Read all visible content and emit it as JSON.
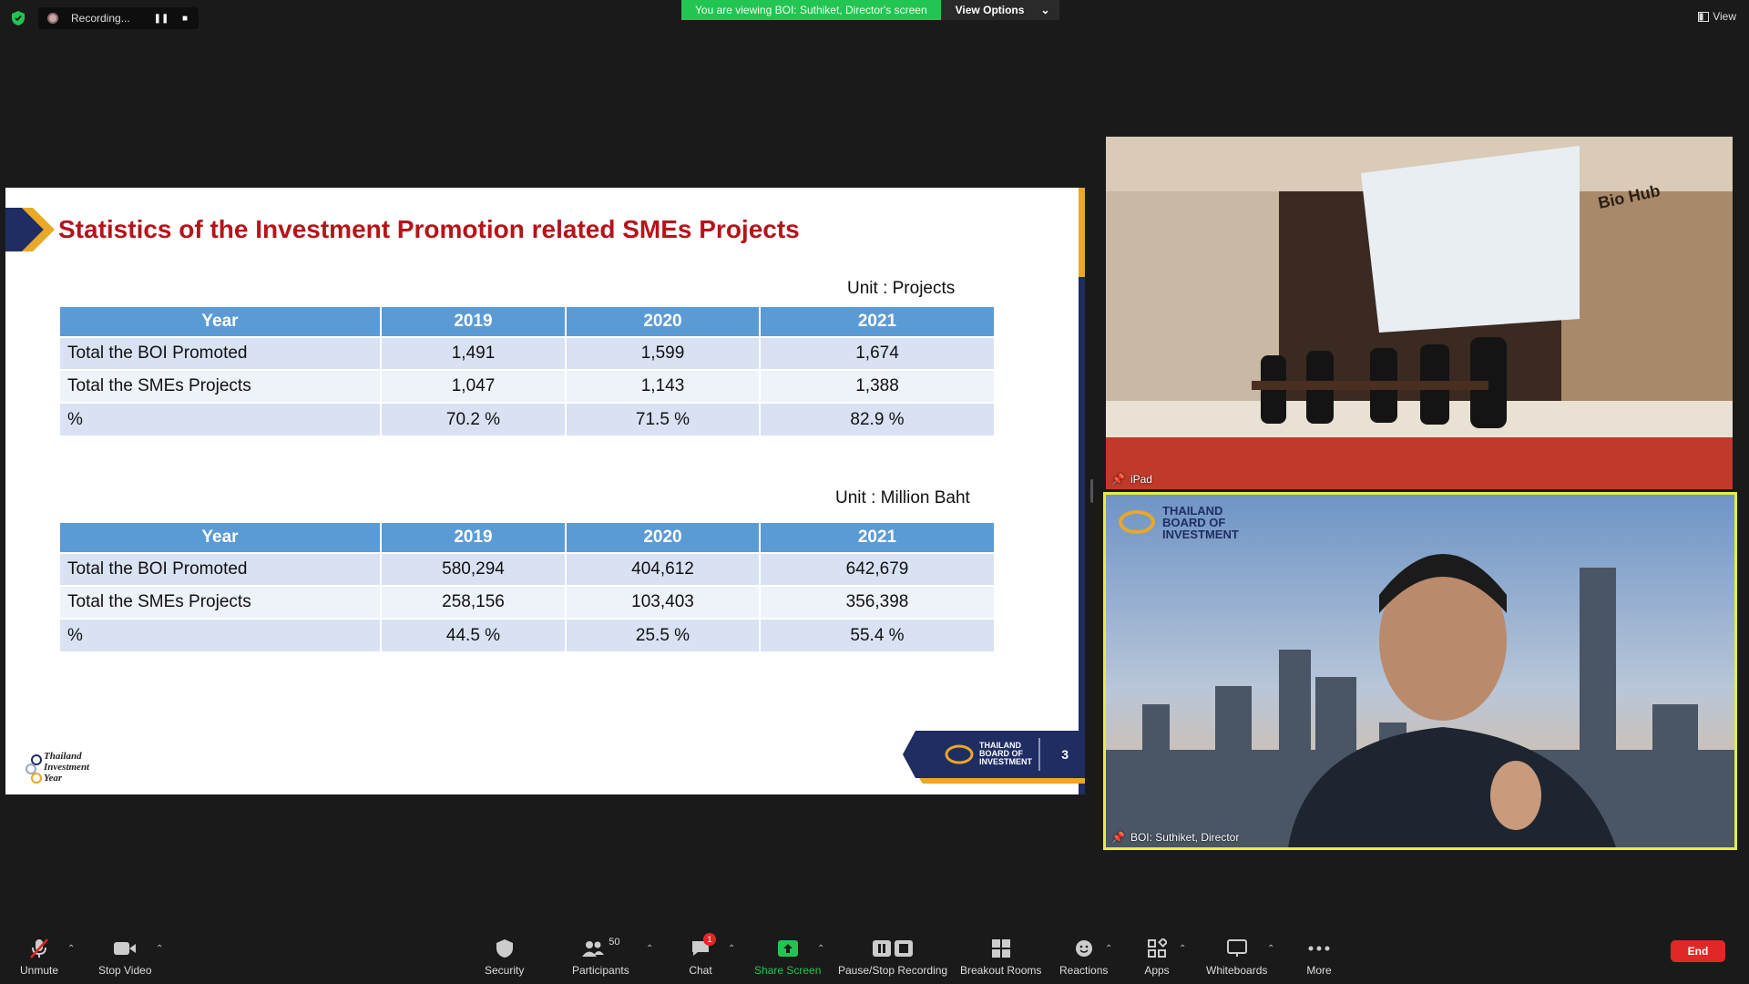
{
  "top": {
    "recording_label": "Recording...",
    "viewing_banner": "You are viewing BOI: Suthiket, Director's screen",
    "view_options_label": "View Options",
    "view_label": "View"
  },
  "slide": {
    "title": "Statistics of the Investment Promotion related SMEs Projects",
    "table1": {
      "unit": "Unit : Projects",
      "headers": [
        "Year",
        "2019",
        "2020",
        "2021"
      ],
      "rows": [
        [
          "Total the BOI Promoted",
          "1,491",
          "1,599",
          "1,674"
        ],
        [
          "Total the SMEs Projects",
          "1,047",
          "1,143",
          "1,388"
        ],
        [
          "%",
          "70.2 %",
          "71.5 %",
          "82.9 %"
        ]
      ]
    },
    "table2": {
      "unit": "Unit : Million Baht",
      "headers": [
        "Year",
        "2019",
        "2020",
        "2021"
      ],
      "rows": [
        [
          "Total the BOI Promoted",
          "580,294",
          "404,612",
          "642,679"
        ],
        [
          "Total the SMEs Projects",
          "258,156",
          "103,403",
          "356,398"
        ],
        [
          "%",
          "44.5 %",
          "25.5 %",
          "55.4 %"
        ]
      ]
    },
    "footer_logo_lines": [
      "Thailand",
      "Investment",
      "Year"
    ],
    "badge_lines": [
      "THAILAND",
      "BOARD OF",
      "INVESTMENT"
    ],
    "page_number": "3"
  },
  "tiles": {
    "ipad_name": "iPad",
    "ipad_screen_text": "Bio Hub",
    "speaker_name": "BOI: Suthiket, Director",
    "speaker_bg_logo": [
      "THAILAND",
      "BOARD OF",
      "INVESTMENT"
    ]
  },
  "toolbar": {
    "unmute": "Unmute",
    "stop_video": "Stop Video",
    "security": "Security",
    "participants": "Participants",
    "participants_count": "50",
    "chat": "Chat",
    "chat_badge": "1",
    "share_screen": "Share Screen",
    "pause_stop_recording": "Pause/Stop Recording",
    "breakout_rooms": "Breakout Rooms",
    "reactions": "Reactions",
    "apps": "Apps",
    "whiteboards": "Whiteboards",
    "more": "More",
    "end": "End"
  },
  "colors": {
    "share_green": "#23c552",
    "end_red": "#e02828",
    "slide_title_red": "#b5141a",
    "table_header_blue": "#5b9bd5",
    "active_speaker_border": "#e4ef3b"
  }
}
